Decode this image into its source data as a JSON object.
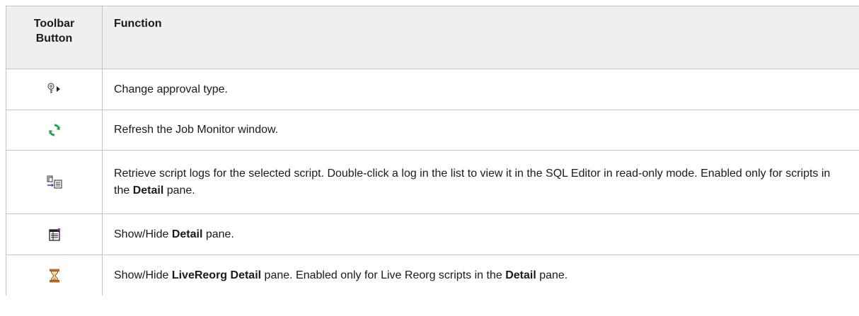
{
  "table": {
    "headers": {
      "button_line1": "Toolbar",
      "button_line2": "Button",
      "function": "Function"
    },
    "rows": [
      {
        "icon": "change-approval-type-icon",
        "parts": [
          {
            "text": "Change approval type.",
            "bold": false
          }
        ]
      },
      {
        "icon": "refresh-icon",
        "parts": [
          {
            "text": "Refresh the Job Monitor window.",
            "bold": false
          }
        ]
      },
      {
        "icon": "retrieve-script-logs-icon",
        "parts": [
          {
            "text": "Retrieve script logs for the selected script. Double-click a log in the list to view it in the SQL Editor in read-only mode. Enabled only for scripts in the ",
            "bold": false
          },
          {
            "text": "Detail",
            "bold": true
          },
          {
            "text": " pane.",
            "bold": false
          }
        ]
      },
      {
        "icon": "detail-pane-icon",
        "parts": [
          {
            "text": "Show/Hide ",
            "bold": false
          },
          {
            "text": "Detail",
            "bold": true
          },
          {
            "text": " pane.",
            "bold": false
          }
        ]
      },
      {
        "icon": "hourglass-icon",
        "parts": [
          {
            "text": "Show/Hide ",
            "bold": false
          },
          {
            "text": "LiveReorg Detail",
            "bold": true
          },
          {
            "text": " pane. Enabled only for Live Reorg scripts in the ",
            "bold": false
          },
          {
            "text": "Detail",
            "bold": true
          },
          {
            "text": " pane.",
            "bold": false
          }
        ]
      }
    ]
  },
  "colors": {
    "header_background": "#efefef",
    "border": "#c4c4c4",
    "refresh_icon_green": "#1fa351"
  }
}
